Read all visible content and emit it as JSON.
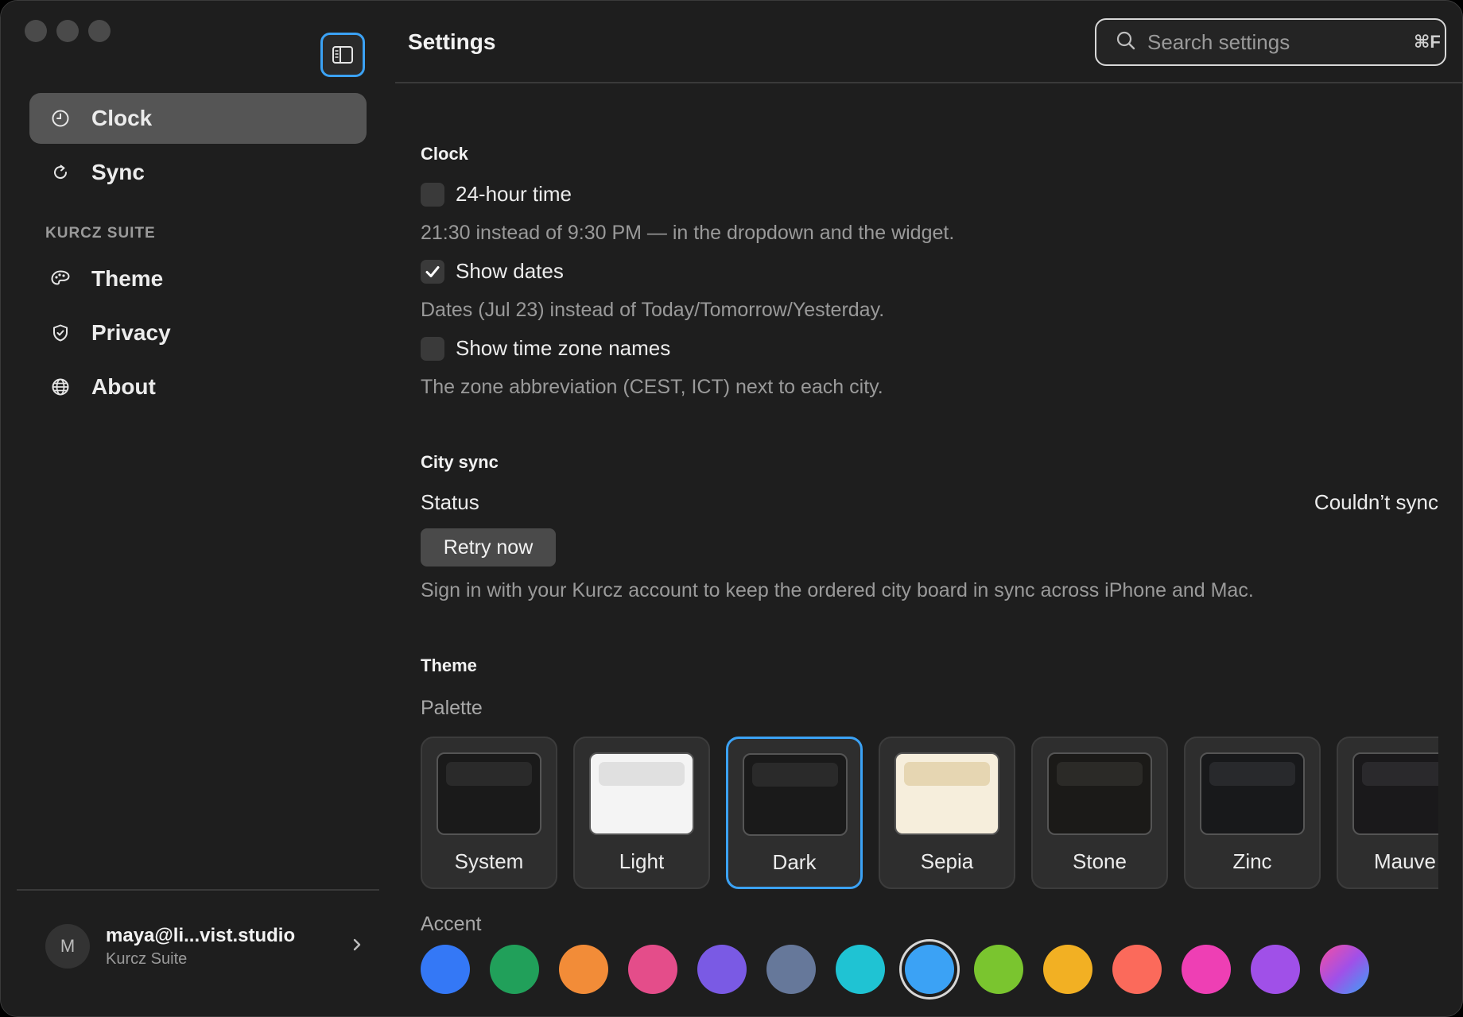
{
  "window": {
    "title": "Settings"
  },
  "sidebar": {
    "items": [
      {
        "label": "Clock",
        "icon": "clock-icon",
        "active": true
      },
      {
        "label": "Sync",
        "icon": "sync-icon",
        "active": false
      }
    ],
    "section_label": "KURCZ SUITE",
    "suite_items": [
      {
        "label": "Theme",
        "icon": "palette-icon"
      },
      {
        "label": "Privacy",
        "icon": "shield-icon"
      },
      {
        "label": "About",
        "icon": "globe-icon"
      }
    ],
    "account": {
      "initial": "M",
      "email": "maya@li...vist.studio",
      "org": "Kurcz Suite"
    }
  },
  "header": {
    "title": "Settings",
    "search_placeholder": "Search settings",
    "search_shortcut": "⌘F"
  },
  "clock": {
    "title": "Clock",
    "options": [
      {
        "label": "24-hour time",
        "checked": false,
        "description": "21:30 instead of 9:30 PM — in the dropdown and the widget."
      },
      {
        "label": "Show dates",
        "checked": true,
        "description": "Dates (Jul 23) instead of Today/Tomorrow/Yesterday."
      },
      {
        "label": "Show time zone names",
        "checked": false,
        "description": "The zone abbreviation (CEST, ICT) next to each city."
      }
    ]
  },
  "city_sync": {
    "title": "City sync",
    "status_label": "Status",
    "status_value": "Couldn’t sync",
    "retry_label": "Retry now",
    "description": "Sign in with your Kurcz account to keep the ordered city board in sync across iPhone and Mac."
  },
  "theme": {
    "title": "Theme",
    "palette_label": "Palette",
    "palettes": [
      {
        "label": "System",
        "bg": "#1a1a1a",
        "bar": "#2a2a2a",
        "selected": false
      },
      {
        "label": "Light",
        "bg": "#f4f4f4",
        "bar": "#e0e0e0",
        "selected": false
      },
      {
        "label": "Dark",
        "bg": "#1a1a1a",
        "bar": "#2a2a2a",
        "selected": true
      },
      {
        "label": "Sepia",
        "bg": "#f6eedc",
        "bar": "#e6d6b2",
        "selected": false
      },
      {
        "label": "Stone",
        "bg": "#1b1a18",
        "bar": "#2b2a27",
        "selected": false
      },
      {
        "label": "Zinc",
        "bg": "#18191b",
        "bar": "#28292c",
        "selected": false
      },
      {
        "label": "Mauve",
        "bg": "#1a191b",
        "bar": "#2a292c",
        "selected": false
      }
    ],
    "accent_label": "Accent",
    "accents": [
      {
        "name": "blue",
        "color": "#3478f6"
      },
      {
        "name": "green",
        "color": "#21a05a"
      },
      {
        "name": "orange",
        "color": "#f28c38"
      },
      {
        "name": "pink",
        "color": "#e44d8a"
      },
      {
        "name": "indigo",
        "color": "#7a5ae4"
      },
      {
        "name": "slate",
        "color": "#66789a"
      },
      {
        "name": "cyan",
        "color": "#1fc3d3"
      },
      {
        "name": "sky",
        "color": "#3ba2f5",
        "selected": true
      },
      {
        "name": "lime",
        "color": "#7ac52f"
      },
      {
        "name": "yellow",
        "color": "#f2b023"
      },
      {
        "name": "coral",
        "color": "#fb6a5b"
      },
      {
        "name": "magenta",
        "color": "#ee3fb4"
      },
      {
        "name": "purple",
        "color": "#a050e8"
      },
      {
        "name": "gradient",
        "color": "linear-gradient(135deg,#f54ea2,#a050e8,#3ba2f5)"
      }
    ]
  }
}
